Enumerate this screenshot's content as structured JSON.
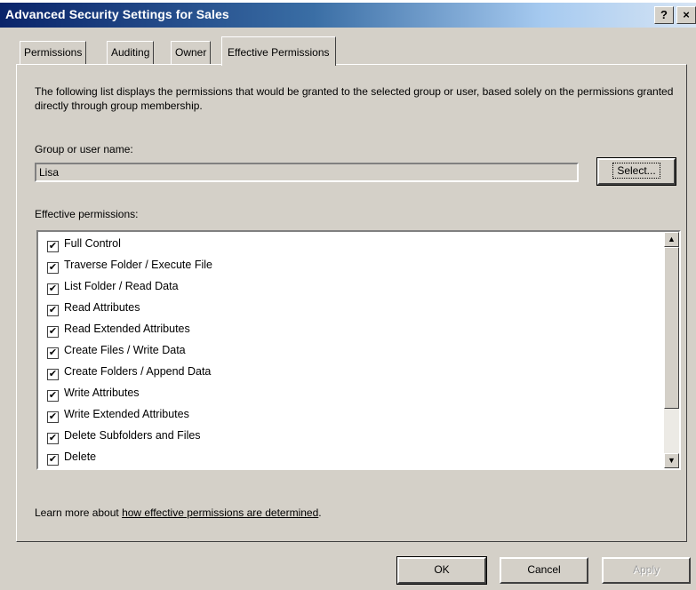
{
  "window": {
    "title": "Advanced Security Settings for Sales",
    "help_label": "?",
    "close_label": "×"
  },
  "tabs": [
    {
      "label": "Permissions"
    },
    {
      "label": "Auditing"
    },
    {
      "label": "Owner"
    },
    {
      "label": "Effective Permissions",
      "active": true
    }
  ],
  "panel": {
    "description": "The following list displays the permissions that would be granted to the selected group or user, based solely on the permissions granted directly through group membership.",
    "group_label": "Group or user name:",
    "group_value": "Lisa",
    "select_label": "Select...",
    "effective_label": "Effective permissions:",
    "permissions": [
      {
        "label": "Full Control",
        "checked": true
      },
      {
        "label": "Traverse Folder / Execute File",
        "checked": true
      },
      {
        "label": "List Folder / Read Data",
        "checked": true
      },
      {
        "label": "Read Attributes",
        "checked": true
      },
      {
        "label": "Read Extended Attributes",
        "checked": true
      },
      {
        "label": "Create Files / Write Data",
        "checked": true
      },
      {
        "label": "Create Folders / Append Data",
        "checked": true
      },
      {
        "label": "Write Attributes",
        "checked": true
      },
      {
        "label": "Write Extended Attributes",
        "checked": true
      },
      {
        "label": "Delete Subfolders and Files",
        "checked": true
      },
      {
        "label": "Delete",
        "checked": true
      }
    ],
    "learn_prefix": "Learn more about ",
    "learn_link": "how effective permissions are determined",
    "learn_suffix": "."
  },
  "buttons": {
    "ok": "OK",
    "cancel": "Cancel",
    "apply": "Apply"
  }
}
